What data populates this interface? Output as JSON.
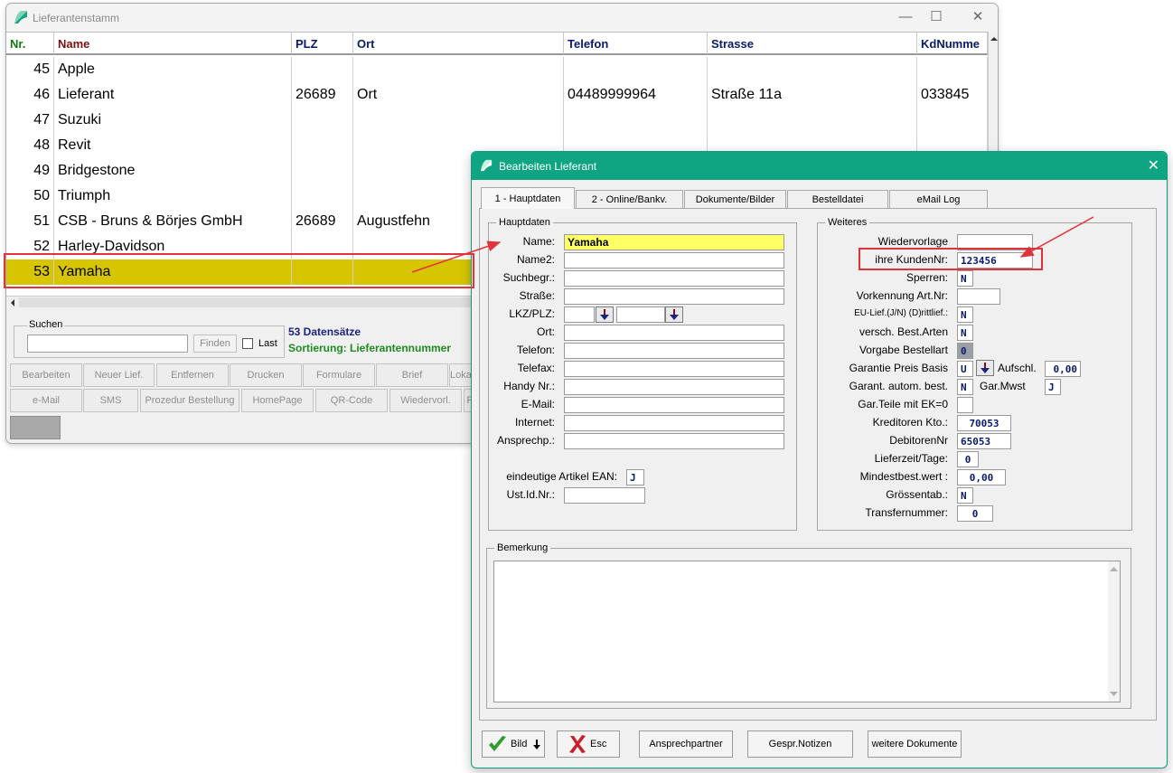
{
  "main_window": {
    "title": "Lieferantenstamm",
    "minimize": "—",
    "maximize": "☐",
    "close": "✕",
    "columns": [
      "Nr.",
      "Name",
      "PLZ",
      "Ort",
      "Telefon",
      "Strasse",
      "KdNumme"
    ],
    "rows": [
      {
        "nr": "45",
        "name": "Apple",
        "plz": "",
        "ort": "",
        "telefon": "",
        "strasse": "",
        "kdnr": ""
      },
      {
        "nr": "46",
        "name": "Lieferant",
        "plz": "26689",
        "ort": "Ort",
        "telefon": "04489999964",
        "strasse": "Straße 11a",
        "kdnr": "033845"
      },
      {
        "nr": "47",
        "name": "Suzuki",
        "plz": "",
        "ort": "",
        "telefon": "",
        "strasse": "",
        "kdnr": ""
      },
      {
        "nr": "48",
        "name": "Revit",
        "plz": "",
        "ort": "",
        "telefon": "",
        "strasse": "",
        "kdnr": ""
      },
      {
        "nr": "49",
        "name": "Bridgestone",
        "plz": "",
        "ort": "",
        "telefon": "",
        "strasse": "",
        "kdnr": ""
      },
      {
        "nr": "50",
        "name": "Triumph",
        "plz": "",
        "ort": "",
        "telefon": "",
        "strasse": "",
        "kdnr": ""
      },
      {
        "nr": "51",
        "name": "CSB - Bruns & Börjes GmbH",
        "plz": "26689",
        "ort": "Augustfehn",
        "telefon": "",
        "strasse": "",
        "kdnr": ""
      },
      {
        "nr": "52",
        "name": "Harley-Davidson",
        "plz": "",
        "ort": "",
        "telefon": "",
        "strasse": "",
        "kdnr": ""
      },
      {
        "nr": "53",
        "name": "Yamaha",
        "plz": "",
        "ort": "",
        "telefon": "",
        "strasse": "",
        "kdnr": ""
      }
    ],
    "search": {
      "legend": "Suchen",
      "value": "",
      "find_label": "Finden",
      "last_label": "Last"
    },
    "record_count": "53 Datensätze",
    "sort_label": "Sortierung: Lieferantennummer",
    "toolbar_row1": [
      "Bearbeiten",
      "Neuer Lief.",
      "Entfernen",
      "Drucken",
      "Formulare",
      "Brief",
      "Lokalisie"
    ],
    "toolbar_row2": [
      "e-Mail",
      "SMS",
      "Prozedur Bestellung",
      "HomePage",
      "QR-Code",
      "Wiedervorl.",
      "P"
    ]
  },
  "dialog": {
    "title": "Bearbeiten Lieferant",
    "close": "✕",
    "tabs": [
      "1 - Hauptdaten",
      "2 - Online/Bankv.",
      "Dokumente/Bilder",
      "Bestelldatei",
      "eMail Log"
    ],
    "hauptdaten": {
      "legend": "Hauptdaten",
      "name_label": "Name:",
      "name_value": "Yamaha",
      "name2_label": "Name2:",
      "suchbegr_label": "Suchbegr.:",
      "strasse_label": "Straße:",
      "lkz_plz_label": "LKZ/PLZ:",
      "ort_label": "Ort:",
      "telefon_label": "Telefon:",
      "telefax_label": "Telefax:",
      "handy_label": "Handy Nr.:",
      "email_label": "E-Mail:",
      "internet_label": "Internet:",
      "ansprechp_label": "Ansprechp.:",
      "ean_label": "eindeutige Artikel EAN:",
      "ean_value": "J",
      "ustid_label": "Ust.Id.Nr.:"
    },
    "weiteres": {
      "legend": "Weiteres",
      "wiedervorlage_label": "Wiedervorlage",
      "kundennr_label": "ihre KundenNr:",
      "kundennr_value": "123456",
      "sperren_label": "Sperren:",
      "sperren_value": "N",
      "vorkennung_label": "Vorkennung Art.Nr:",
      "eu_lief_label": "EU-Lief.(J/N) (D)rittlief.:",
      "eu_lief_value": "N",
      "versch_label": "versch. Best.Arten",
      "versch_value": "N",
      "vorgabe_label": "Vorgabe Bestellart",
      "vorgabe_value": "0",
      "garantie_label": "Garantie Preis Basis",
      "garantie_value": "U",
      "aufschl_label": "Aufschl.",
      "aufschl_value": "0,00",
      "garant_autom_label": "Garant. autom. best.",
      "garant_autom_value": "N",
      "gar_mwst_label": "Gar.Mwst",
      "gar_mwst_value": "J",
      "garteile_label": "Gar.Teile mit EK=0",
      "kreditoren_label": "Kreditoren Kto.:",
      "kreditoren_value": "70053",
      "debitoren_label": "DebitorenNr",
      "debitoren_value": "65053",
      "lieferzeit_label": "Lieferzeit/Tage:",
      "lieferzeit_value": "0",
      "mindest_label": "Mindestbest.wert :",
      "mindest_value": "0,00",
      "groessen_label": "Grössentab.:",
      "groessen_value": "N",
      "transfer_label": "Transfernummer:",
      "transfer_value": "0"
    },
    "bemerkung_legend": "Bemerkung",
    "buttons": {
      "bild": "Bild",
      "esc": "Esc",
      "ansprechpartner": "Ansprechpartner",
      "gespr_notizen": "Gespr.Notizen",
      "weitere": "weitere Dokumente"
    }
  },
  "colors": {
    "dialog_title": "#0fa582",
    "selected_row": "#d6c500",
    "highlight": "#e0343c"
  }
}
